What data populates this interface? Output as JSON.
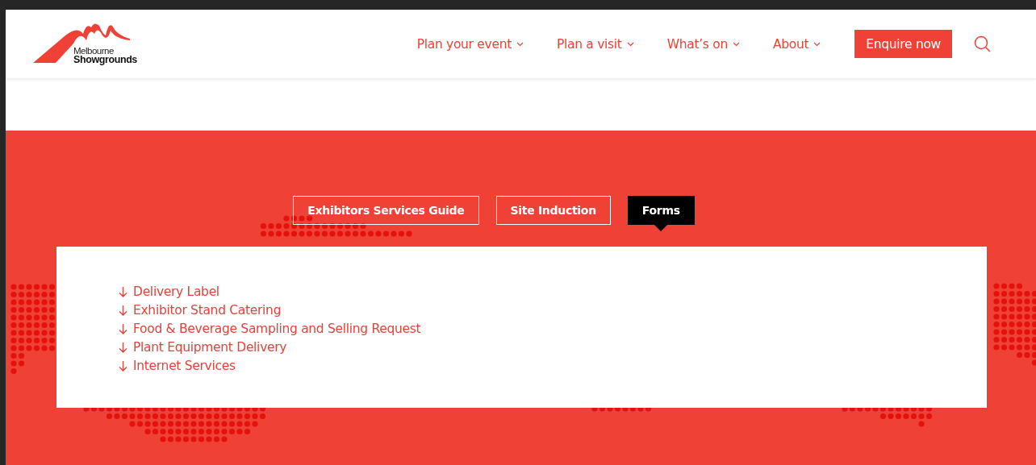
{
  "header": {
    "logo": {
      "line_1": "Melbourne",
      "line_2": "Showgrounds"
    },
    "nav": [
      {
        "label": "Plan your event",
        "kind": "dropdown"
      },
      {
        "label": "Plan a visit",
        "kind": "dropdown"
      },
      {
        "label": "What’s on",
        "kind": "dropdown"
      },
      {
        "label": "About",
        "kind": "dropdown"
      },
      {
        "label": "Enquire now",
        "kind": "button"
      }
    ]
  },
  "tabs": [
    {
      "label": "Exhibitors Services Guide",
      "selected": false
    },
    {
      "label": "Site Induction",
      "selected": false
    },
    {
      "label": "Forms",
      "selected": true
    }
  ],
  "downloads": [
    "Delivery Label",
    "Exhibitor Stand Catering",
    "Food & Beverage Sampling and Selling Request",
    "Plant Equipment Delivery",
    "Internet Services"
  ]
}
